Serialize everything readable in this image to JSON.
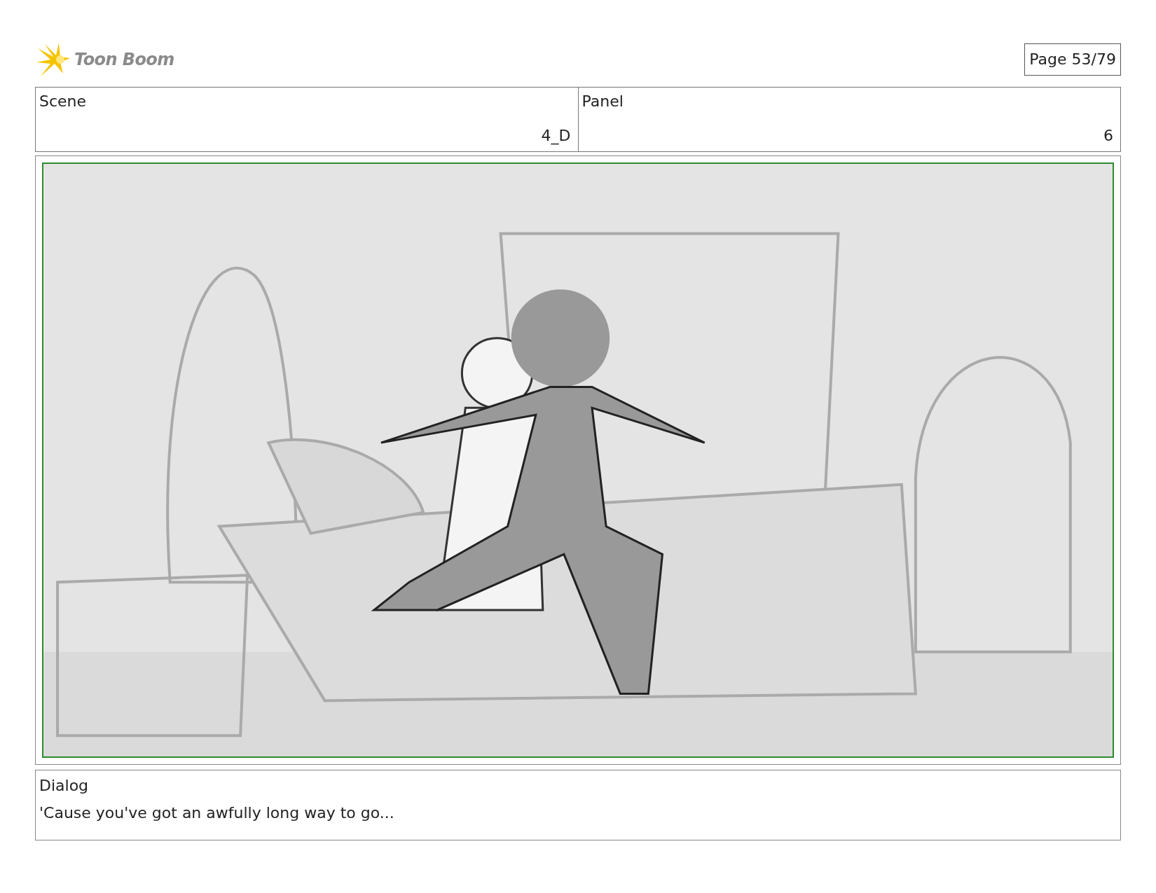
{
  "logo": {
    "text": "Toon Boom"
  },
  "page_label": "Page 53/79",
  "scene": {
    "label": "Scene",
    "number": "4_D"
  },
  "panel": {
    "label": "Panel",
    "number": "6"
  },
  "dialog": {
    "label": "Dialog",
    "text": "'Cause you've got an awfully long way to go..."
  }
}
